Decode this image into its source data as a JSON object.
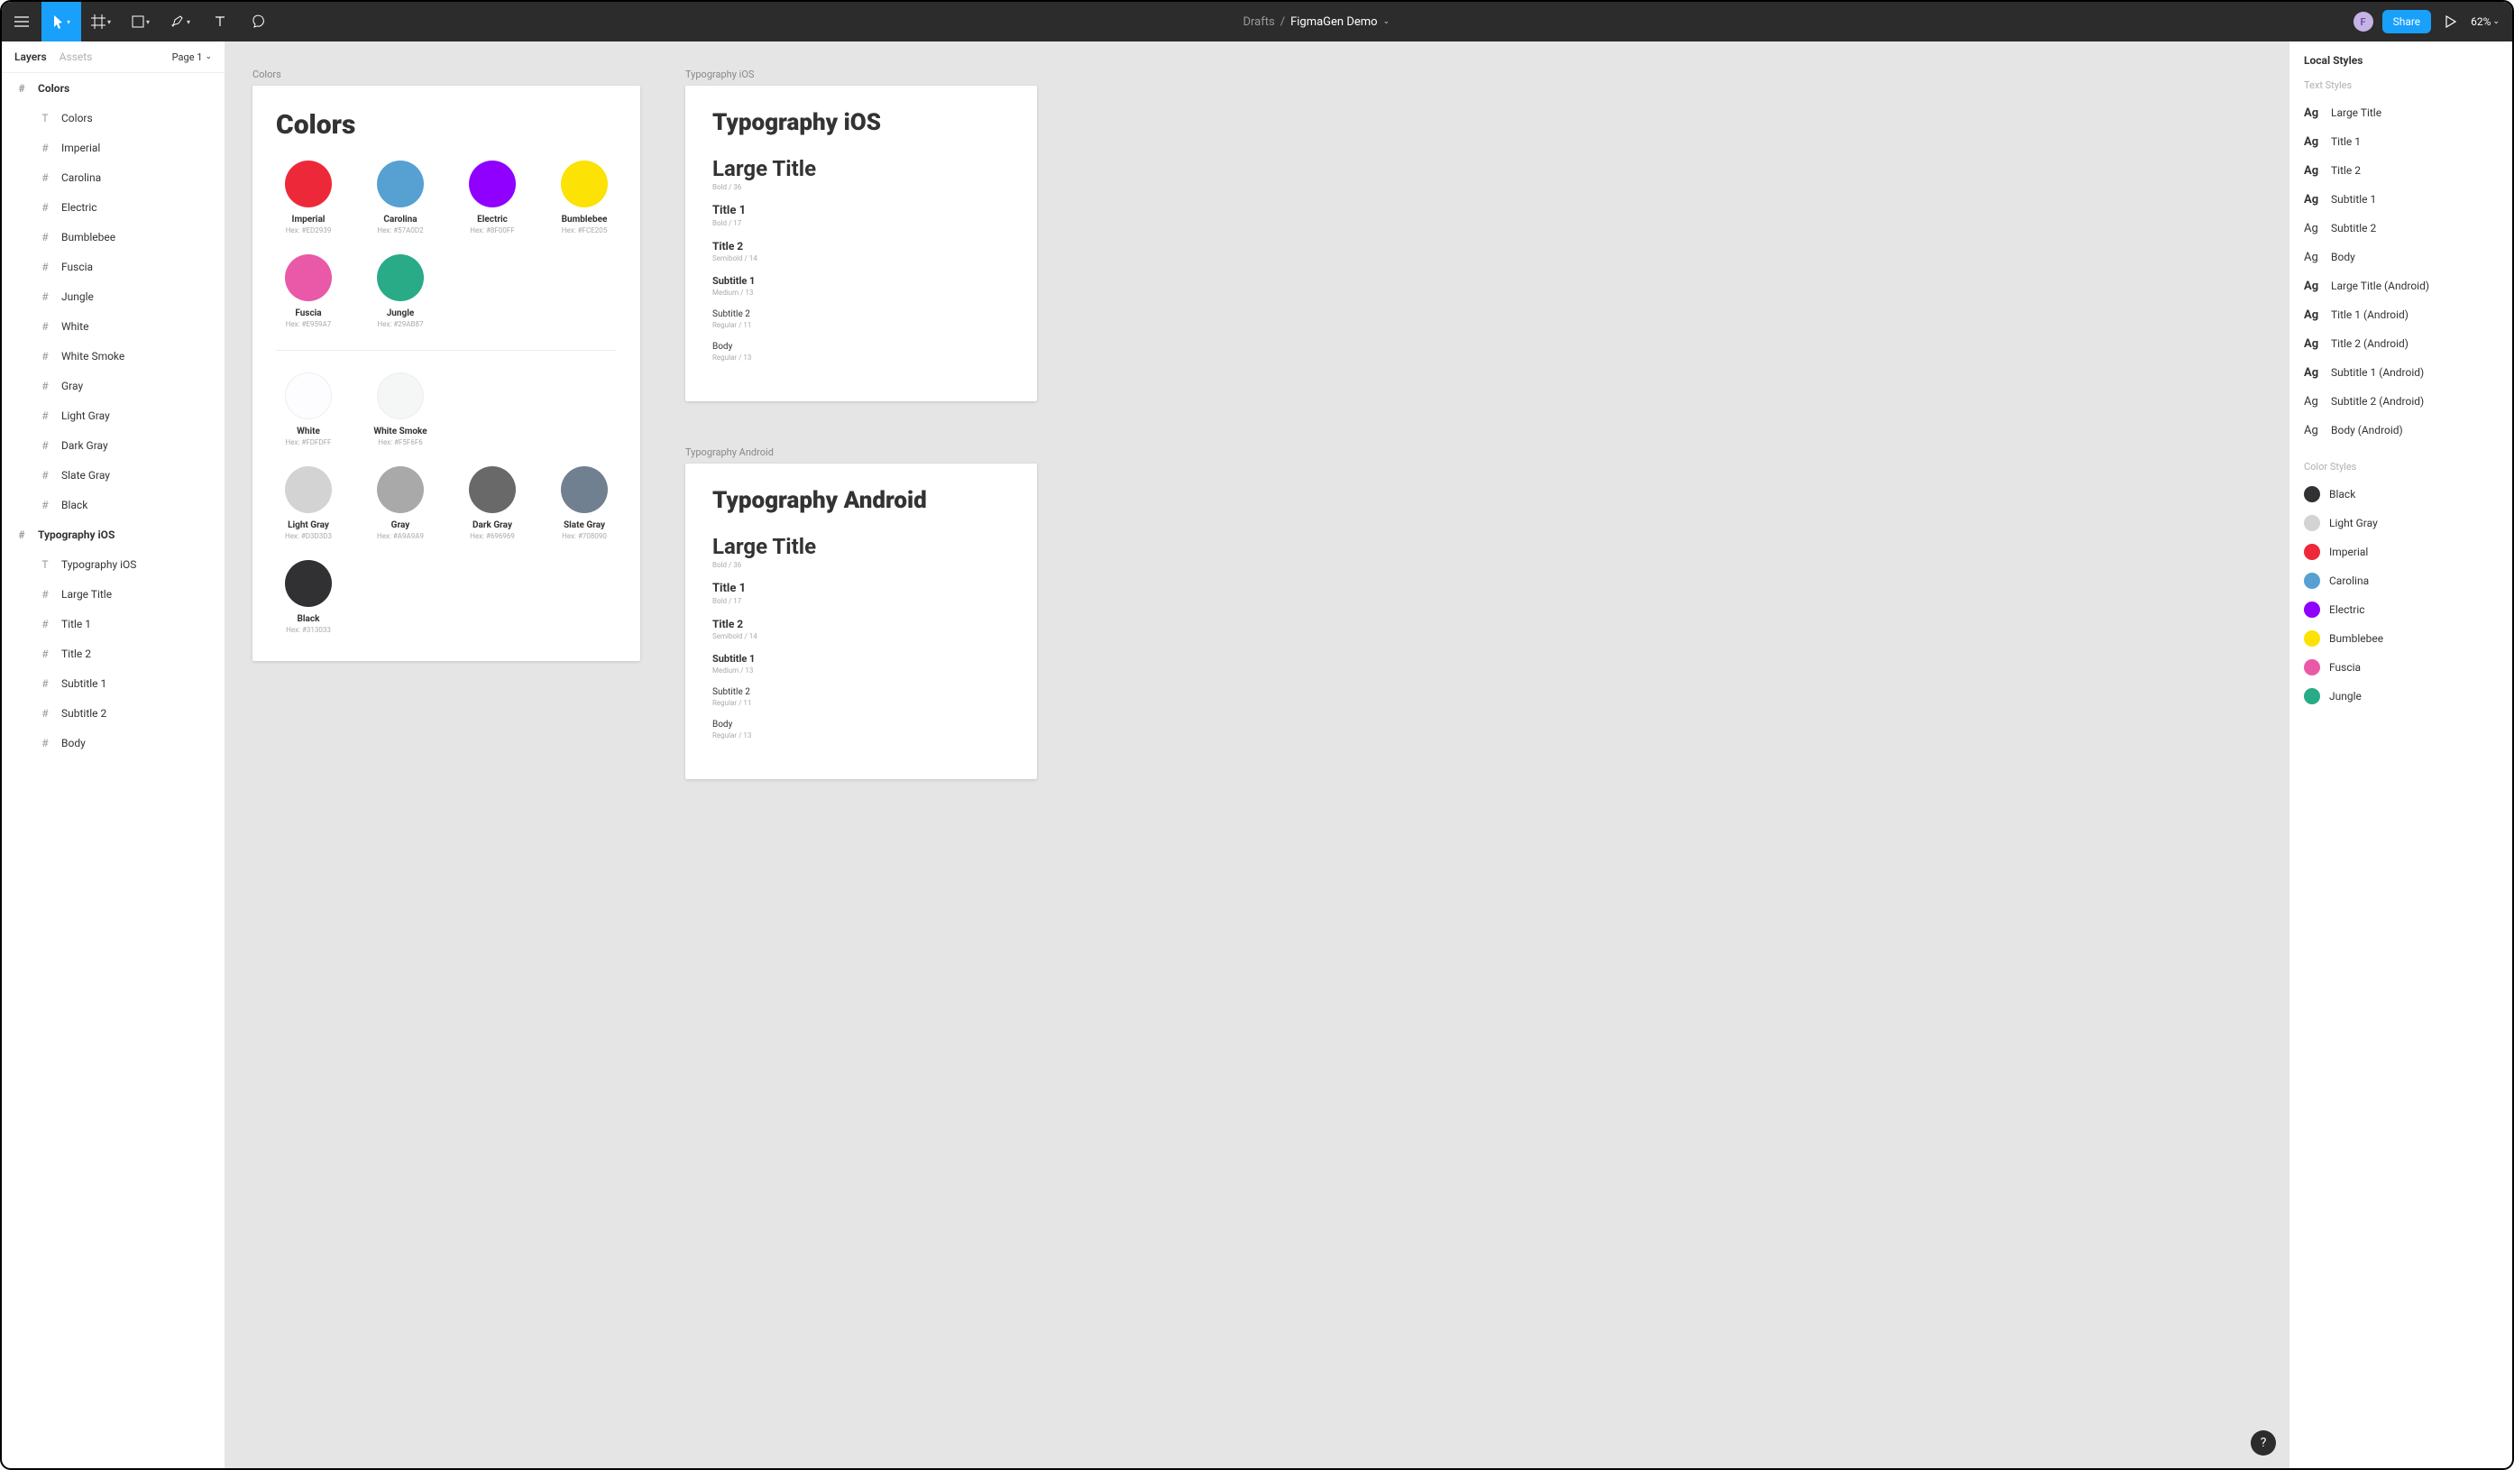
{
  "toolbar": {
    "breadcrumb_parent": "Drafts",
    "breadcrumb_sep": "/",
    "file_name": "FigmaGen Demo",
    "avatar_letter": "F",
    "share_label": "Share",
    "zoom": "62%"
  },
  "left_panel": {
    "tabs": {
      "layers": "Layers",
      "assets": "Assets"
    },
    "page_label": "Page 1",
    "frames": [
      {
        "name": "Colors",
        "children": [
          {
            "icon": "T",
            "label": "Colors"
          },
          {
            "icon": "#",
            "label": "Imperial"
          },
          {
            "icon": "#",
            "label": "Carolina"
          },
          {
            "icon": "#",
            "label": "Electric"
          },
          {
            "icon": "#",
            "label": "Bumblebee"
          },
          {
            "icon": "#",
            "label": "Fuscia"
          },
          {
            "icon": "#",
            "label": "Jungle"
          },
          {
            "icon": "#",
            "label": "White"
          },
          {
            "icon": "#",
            "label": "White Smoke"
          },
          {
            "icon": "#",
            "label": "Gray"
          },
          {
            "icon": "#",
            "label": "Light Gray"
          },
          {
            "icon": "#",
            "label": "Dark Gray"
          },
          {
            "icon": "#",
            "label": "Slate Gray"
          },
          {
            "icon": "#",
            "label": "Black"
          }
        ]
      },
      {
        "name": "Typography iOS",
        "children": [
          {
            "icon": "T",
            "label": "Typography iOS"
          },
          {
            "icon": "#",
            "label": "Large Title"
          },
          {
            "icon": "#",
            "label": "Title 1"
          },
          {
            "icon": "#",
            "label": "Title 2"
          },
          {
            "icon": "#",
            "label": "Subtitle 1"
          },
          {
            "icon": "#",
            "label": "Subtitle 2"
          },
          {
            "icon": "#",
            "label": "Body"
          }
        ]
      }
    ]
  },
  "canvas": {
    "colors_frame": {
      "label": "Colors",
      "title": "Colors",
      "row1": [
        {
          "name": "Imperial",
          "hex": "#ED2939"
        },
        {
          "name": "Carolina",
          "hex": "#57A0D2"
        },
        {
          "name": "Electric",
          "hex": "#8F00FF"
        },
        {
          "name": "Bumblebee",
          "hex": "#FCE205"
        }
      ],
      "row2": [
        {
          "name": "Fuscia",
          "hex": "#E959A7"
        },
        {
          "name": "Jungle",
          "hex": "#29AB87"
        }
      ],
      "row3": [
        {
          "name": "White",
          "hex": "#FDFDFF",
          "bordered": true
        },
        {
          "name": "White Smoke",
          "hex": "#F5F6F6",
          "bordered": true
        }
      ],
      "row4": [
        {
          "name": "Light Gray",
          "hex": "#D3D3D3"
        },
        {
          "name": "Gray",
          "hex": "#A9A9A9"
        },
        {
          "name": "Dark Gray",
          "hex": "#696969"
        },
        {
          "name": "Slate Gray",
          "hex": "#708090"
        }
      ],
      "row5": [
        {
          "name": "Black",
          "hex": "#313033"
        }
      ]
    },
    "typo_ios": {
      "label": "Typography iOS",
      "title": "Typography iOS",
      "rows": [
        {
          "cls": "t-large-title",
          "text": "Large Title",
          "meta": "Bold / 36"
        },
        {
          "cls": "t-title1",
          "text": "Title 1",
          "meta": "Bold / 17"
        },
        {
          "cls": "t-title2",
          "text": "Title 2",
          "meta": "Semibold / 14"
        },
        {
          "cls": "t-sub1",
          "text": "Subtitle 1",
          "meta": "Medium / 13"
        },
        {
          "cls": "t-sub2",
          "text": "Subtitle 2",
          "meta": "Regular / 11"
        },
        {
          "cls": "t-body",
          "text": "Body",
          "meta": "Regular / 13"
        }
      ]
    },
    "typo_android": {
      "label": "Typography Android",
      "title": "Typography Android",
      "rows": [
        {
          "cls": "t-large-title",
          "text": "Large Title",
          "meta": "Bold / 36"
        },
        {
          "cls": "t-title1",
          "text": "Title 1",
          "meta": "Bold / 17"
        },
        {
          "cls": "t-title2",
          "text": "Title 2",
          "meta": "Semibold / 14"
        },
        {
          "cls": "t-sub1",
          "text": "Subtitle 1",
          "meta": "Medium / 13"
        },
        {
          "cls": "t-sub2",
          "text": "Subtitle 2",
          "meta": "Regular / 11"
        },
        {
          "cls": "t-body",
          "text": "Body",
          "meta": "Regular / 13"
        }
      ]
    }
  },
  "right_panel": {
    "heading": "Local Styles",
    "text_styles_heading": "Text Styles",
    "text_styles": [
      {
        "weight": "bold",
        "label": "Large Title"
      },
      {
        "weight": "bold",
        "label": "Title 1"
      },
      {
        "weight": "bold",
        "label": "Title 2"
      },
      {
        "weight": "bold",
        "label": "Subtitle 1"
      },
      {
        "weight": "reg",
        "label": "Subtitle 2"
      },
      {
        "weight": "reg",
        "label": "Body"
      },
      {
        "weight": "bold",
        "label": "Large Title (Android)"
      },
      {
        "weight": "bold",
        "label": "Title 1 (Android)"
      },
      {
        "weight": "bold",
        "label": "Title 2 (Android)"
      },
      {
        "weight": "bold",
        "label": "Subtitle 1 (Android)"
      },
      {
        "weight": "reg",
        "label": "Subtitle 2 (Android)"
      },
      {
        "weight": "reg",
        "label": "Body (Android)"
      }
    ],
    "color_styles_heading": "Color Styles",
    "color_styles": [
      {
        "label": "Black",
        "hex": "#313033"
      },
      {
        "label": "Light Gray",
        "hex": "#D3D3D3"
      },
      {
        "label": "Imperial",
        "hex": "#ED2939"
      },
      {
        "label": "Carolina",
        "hex": "#57A0D2"
      },
      {
        "label": "Electric",
        "hex": "#8F00FF"
      },
      {
        "label": "Bumblebee",
        "hex": "#FCE205"
      },
      {
        "label": "Fuscia",
        "hex": "#E959A7"
      },
      {
        "label": "Jungle",
        "hex": "#29AB87"
      }
    ]
  },
  "help_label": "?"
}
